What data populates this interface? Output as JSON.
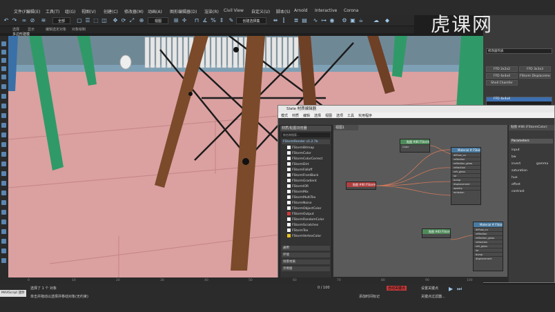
{
  "menu": {
    "items": [
      "文件(F)",
      "编辑(E)",
      "工具(T)",
      "组(G)",
      "视图(V)",
      "创建(C)",
      "修改器(M)",
      "动画(A)",
      "图形编辑器(D)",
      "渲染(R)",
      "Civil View",
      "自定义(U)",
      "脚本(S)",
      "Arnold",
      "Interactive",
      "Corona"
    ]
  },
  "toolbar2": {
    "items": [
      "选择",
      "显示",
      "编辑选定对象",
      "对象绘制"
    ]
  },
  "viewport_label": "多边形建模",
  "command_panel": {
    "label": "修改器列表",
    "buttons": [
      "FFD 2x2x2",
      "FFD 3x3x3",
      "FFD 4x4x4",
      "FStorm Displacement",
      "Shell Chamfer"
    ],
    "stack_item": "FFD 4x4x4"
  },
  "slate": {
    "title": "Slate 材质编辑器",
    "menu": [
      "模式",
      "材质",
      "编辑",
      "选择",
      "视图",
      "选项",
      "工具",
      "实用程序"
    ],
    "browser_title": "材质/贴图浏览器",
    "browser_search": "按名称搜索...",
    "maps_group": "FStormRender v1.2.7b",
    "map_items": [
      "FStormBitmap",
      "FStormColor",
      "FStormColorCorrect",
      "FStormDirt",
      "FStormFalloff",
      "FStormFrontBack",
      "FStormGradient",
      "FStormIOR",
      "FStormMix",
      "FStormMultiTex",
      "FStormNoise",
      "FStormObjectColor",
      "FStormOutput",
      "FStormRandomColor",
      "FStormScratches",
      "FStormTex",
      "FStormVertexColor"
    ],
    "group_general": "通用",
    "group_env": "环境",
    "group_scene": "场景材质",
    "group_sample": "示例窗",
    "view_tab": "视图1",
    "params_title": "贴图 #86 (FStormColor)",
    "params_header": "Parameters",
    "params_rows": [
      "input",
      "bw",
      "invert",
      "saturation",
      "hue",
      "offset",
      "contrast"
    ],
    "params_value": "gamma",
    "status_text": "已完成渲染"
  },
  "nodes": {
    "n1": "贴图 #86\nFStormColor",
    "n2": "Material #\nFStorm",
    "n3": "贴图 #90\nFStormBitmap",
    "n4": "贴图 #83\nFStormBitmap",
    "n5": "Material #\nFStorm",
    "mat_slots": [
      "diffuse_co",
      "reflection",
      "reflection_gloss",
      "refraction",
      "refr_gloss",
      "ior",
      "bump",
      "displacement",
      "opacity",
      "emission",
      "coat",
      "sheen"
    ]
  },
  "timeline": {
    "ticks": [
      "0",
      "10",
      "20",
      "30",
      "40",
      "50",
      "60",
      "70",
      "80",
      "90",
      "100"
    ],
    "frame": "0 / 100"
  },
  "status": {
    "selected": "选择了 1 个 对象",
    "hint": "单击并拖动以选择并移动对象(无约束)",
    "maxscript": "MAXScript 迷你",
    "add_time": "添加时间标记",
    "auto_key": "自动关键点",
    "set_key": "设置关键点",
    "filter": "关键点过滤器..."
  },
  "watermark": "虎课网"
}
